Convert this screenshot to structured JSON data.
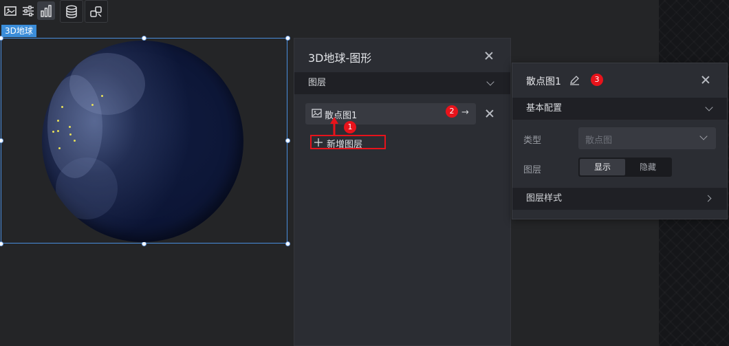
{
  "toolbar": {
    "buttons": [
      {
        "icon": "image-icon"
      },
      {
        "icon": "sliders-icon"
      },
      {
        "icon": "bar-chart-icon"
      },
      {
        "icon": "database-icon"
      },
      {
        "icon": "shapes-icon"
      }
    ]
  },
  "canvas": {
    "component_tag": "3D地球"
  },
  "shape_panel": {
    "title": "3D地球-图形",
    "layers_section_label": "图层",
    "layer_item_label": "散点图1",
    "add_layer_label": "新增图层",
    "badges": {
      "add_step": "1",
      "open_step": "2"
    }
  },
  "layer_config_panel": {
    "title": "散点图1",
    "badge": "3",
    "basic_section_label": "基本配置",
    "type_label": "类型",
    "type_value": "散点图",
    "layer_label": "图层",
    "show_option": "显示",
    "hide_option": "隐藏",
    "style_section_label": "图层样式"
  },
  "colors": {
    "accent_blue": "#3b8dd9",
    "highlight_red": "#e8131b",
    "scatter_dot": "#e7e05a"
  }
}
